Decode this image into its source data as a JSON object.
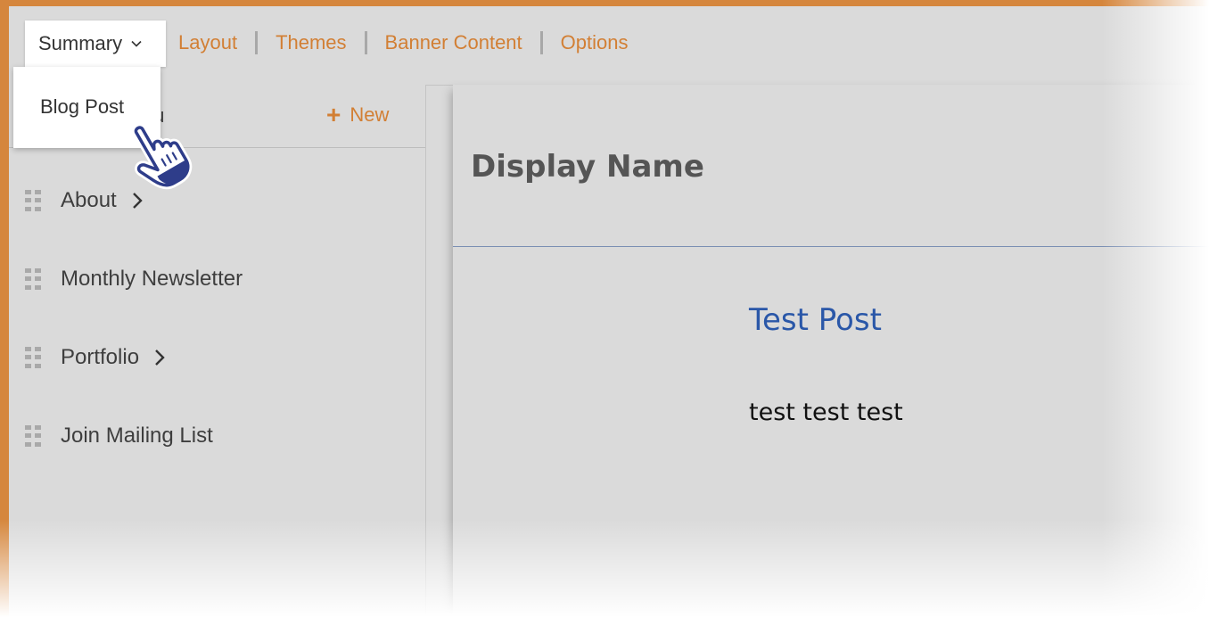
{
  "nav": {
    "summary_label": "Summary",
    "links": [
      "Layout",
      "Themes",
      "Banner Content",
      "Options"
    ]
  },
  "dropdown": {
    "item": "Blog Post"
  },
  "sidebar": {
    "title_visible": "nu",
    "new_label": "New",
    "items": [
      {
        "label": "About",
        "has_children": true
      },
      {
        "label": "Monthly Newsletter",
        "has_children": false
      },
      {
        "label": "Portfolio",
        "has_children": true
      },
      {
        "label": "Join Mailing List",
        "has_children": false
      }
    ]
  },
  "main": {
    "display_name": "Display Name",
    "post_title": "Test Post",
    "post_body": "test test test"
  },
  "colors": {
    "accent": "#d27f34",
    "link_blue": "#2a57a8",
    "frame": "#d5863d",
    "panel_bg": "#dadada"
  },
  "icons": [
    "chevron-down-icon",
    "plus-icon",
    "drag-handle-icon",
    "chevron-right-icon",
    "pointer-hand-icon"
  ]
}
